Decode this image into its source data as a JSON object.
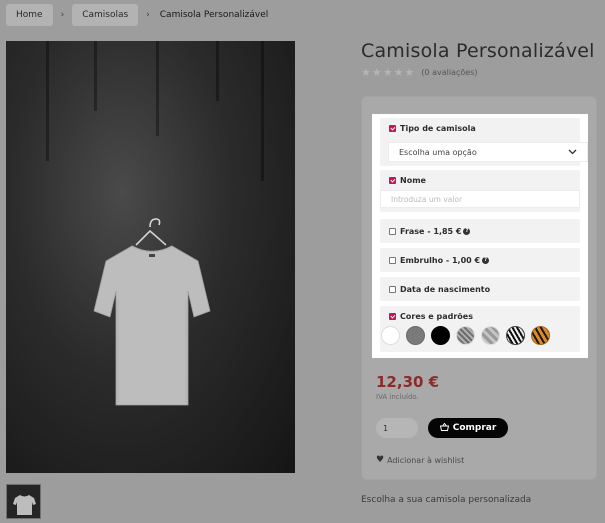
{
  "breadcrumb": {
    "home": "Home",
    "category": "Camisolas",
    "current": "Camisola Personalizável",
    "separator": "›"
  },
  "product": {
    "title": "Camisola Personalizável",
    "stars": "★★★★★",
    "rating_text": "(0 avaliações)",
    "price": "12,30 €",
    "vat_note": "IVA incluído.",
    "quantity": "1",
    "buy_label": "Comprar",
    "wishlist_label": "Adicionar à wishlist",
    "description": "Escolha a sua camisola personalizada",
    "price_color": "#8b2b2b"
  },
  "options": {
    "tipo": {
      "label": "Tipo de camisola",
      "checked": true,
      "select_value": "Escolha uma opção"
    },
    "nome": {
      "label": "Nome",
      "checked": true,
      "placeholder": "Introduza um valor"
    },
    "frase": {
      "label": "Frase - 1,85 €",
      "checked": false
    },
    "embrulho": {
      "label": "Embrulho - 1,00 €",
      "checked": false
    },
    "data": {
      "label": "Data de nascimento",
      "checked": false
    },
    "cores": {
      "label": "Cores e padrões",
      "checked": true
    },
    "check_color": "#c2185b"
  },
  "swatches": [
    "white",
    "grey",
    "black",
    "grey-diamond-pattern",
    "grey-checker-pattern",
    "zebra-pattern",
    "tiger-pattern"
  ]
}
